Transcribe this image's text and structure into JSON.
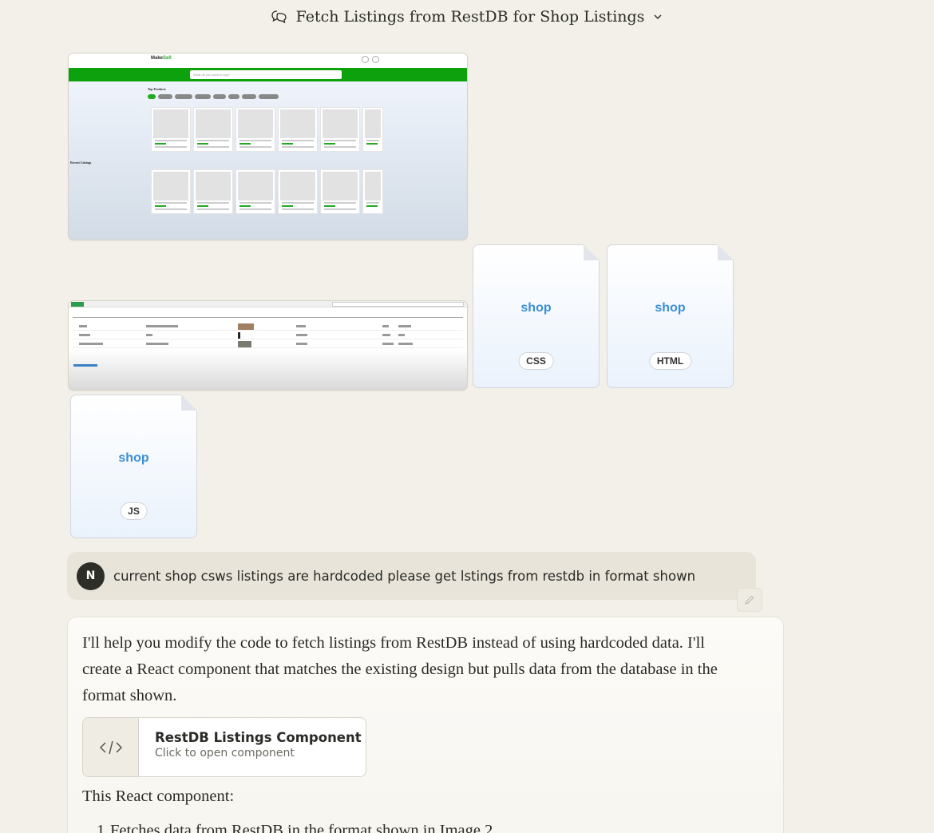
{
  "header": {
    "title": "Fetch Listings from RestDB for Shop Listings"
  },
  "screenshot1": {
    "logo_part1": "Make",
    "logo_part2": "Sell",
    "search_placeholder": "What do you want to buy?",
    "top_products": "Top Products",
    "recent_listings": "Recent Listings"
  },
  "files": [
    {
      "name": "shop",
      "type": "CSS"
    },
    {
      "name": "shop",
      "type": "HTML"
    },
    {
      "name": "shop",
      "type": "JS"
    }
  ],
  "user": {
    "avatar": "N",
    "message": "current shop csws listings are hardcoded please get lstings from restdb in format shown"
  },
  "assistant": {
    "intro": "I'll help you modify the code to fetch listings from RestDB instead of using hardcoded data. I'll create a React component that matches the existing design but pulls data from the database in the format shown.",
    "artifact_title": "RestDB Listings Component",
    "artifact_subtitle": "Click to open component",
    "summary": "This React component:",
    "list": [
      {
        "num": "1.",
        "text": "Fetches data from RestDB in the format shown in Image 2"
      }
    ]
  },
  "colors": {
    "accent_blue": "#3b8fd6",
    "brand_green": "#0ea10e",
    "background": "#f2f0e8"
  }
}
